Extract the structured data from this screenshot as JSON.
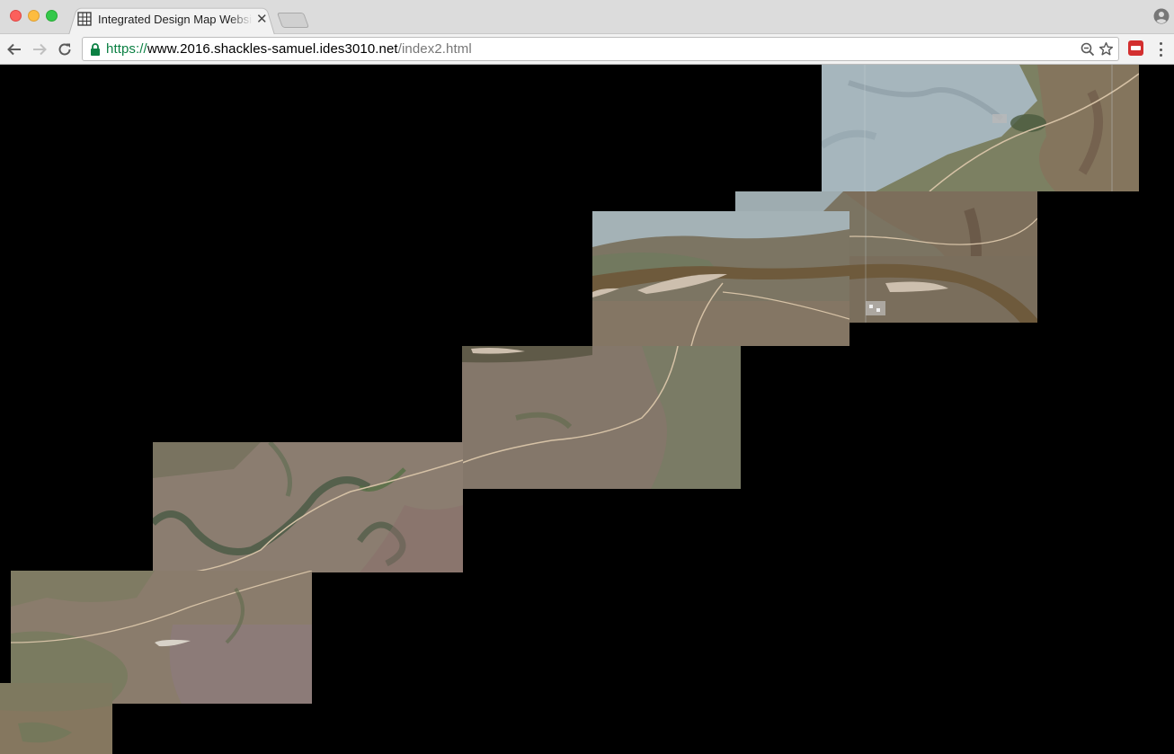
{
  "browser": {
    "tab": {
      "title": "Integrated Design Map Website",
      "favicon": "map-grid-favicon-icon"
    },
    "address_bar": {
      "scheme": "https://",
      "host": "www.2016.shackles-samuel.ides3010.net",
      "path": "/index2.html"
    },
    "icons": {
      "back": "arrow-left-icon",
      "forward": "arrow-right-icon",
      "reload": "reload-icon",
      "lock": "lock-icon",
      "zoom": "zoom-out-icon",
      "bookmark": "star-icon",
      "extension": "extension-icon",
      "menu": "more-vertical-icon",
      "profile": "person-circle-icon"
    }
  },
  "page": {
    "background": "#000000",
    "content": "satellite imagery map tiles",
    "colors": {
      "river": "#6e5a3c",
      "sandbar": "#cdbfae",
      "rock_plateau": "#a6b6bd",
      "scrub": "#7c8062",
      "dirt_road": "#d6c2a6"
    }
  }
}
